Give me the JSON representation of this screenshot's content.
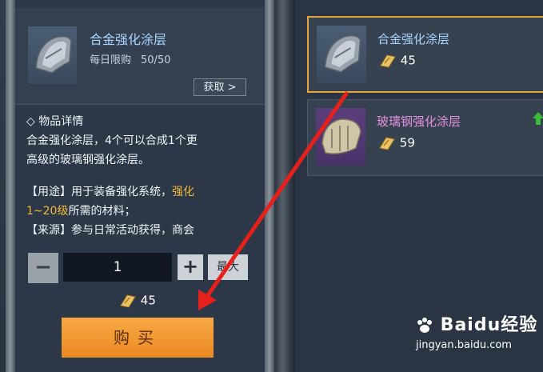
{
  "detail": {
    "item_name": "合金强化涂层",
    "daily_limit_label": "每日限购",
    "daily_limit_count": "50/50",
    "get_button": "获取 >",
    "section_title": "◇ 物品详情",
    "description_line1": "合金强化涂层，4个可以合成1个更",
    "description_line2": "高级的玻璃钢强化涂层。",
    "usage_prefix": "【用途】用于装备强化系统，",
    "usage_highlight1": "强化",
    "usage_highlight2": "1~20级",
    "usage_suffix": "所需的材料；",
    "source_partial": "【来源】参与日常活动获得，商会"
  },
  "purchase": {
    "minus_label": "−",
    "quantity": "1",
    "plus_label": "+",
    "max_label": "最大",
    "total_price": "45",
    "buy_label": "购买"
  },
  "shop_list": [
    {
      "name": "合金强化涂层",
      "price": "45",
      "selected": true
    },
    {
      "name": "玻璃钢强化涂层",
      "price": "59",
      "selected": false
    }
  ],
  "watermark": {
    "logo_text": "Baidu经验",
    "url": "jingyan.baidu.com"
  },
  "colors": {
    "accent_orange": "#eb8a22",
    "selected_border": "#e8a33a",
    "name_blue": "#a9d4ff",
    "name_purple": "#e58fe0",
    "annotation_red": "#e8201c"
  },
  "icons": [
    "coupon-icon",
    "armor-plate-icon",
    "upgrade-arrow-icon",
    "paw-logo-icon"
  ]
}
